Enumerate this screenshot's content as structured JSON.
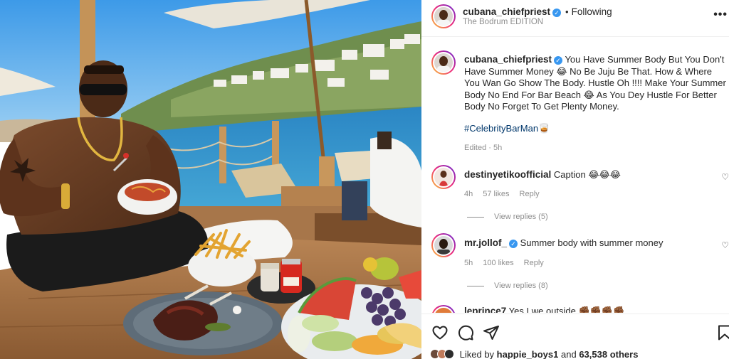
{
  "post": {
    "author": "cubana_chiefpriest",
    "verified_mark": "✓",
    "separator": "•",
    "following_label": "Following",
    "location": "The Bodrum EDITION",
    "more_icon": "more-horizontal-icon"
  },
  "caption": {
    "author": "cubana_chiefpriest",
    "text": "You Have Summer Body But You Don't Have Summer Money 😂 No Be Juju Be That. How & Where You Wan Go Show The Body. Hustle Oh !!!! Make Your Summer Body No End For Bar Beach 😂 As You Dey Hustle For Better Body No Forget To Get Plenty Money.",
    "hashtag": "#CelebrityBarMan🥃",
    "edited": "Edited",
    "time": "5h"
  },
  "comments": [
    {
      "author": "destinyetikoofficial",
      "text": "Caption 😂😂😂",
      "time": "4h",
      "likes": "57 likes",
      "reply": "Reply",
      "view_replies": "View replies (5)"
    },
    {
      "author": "mr.jollof_",
      "text": "Summer body with summer money",
      "time": "5h",
      "likes": "100 likes",
      "reply": "Reply",
      "view_replies": "View replies (8)"
    },
    {
      "author": "leprince7",
      "text": "Yes I we outside ✊🏾✊🏾✊🏾✊🏾"
    }
  ],
  "actions": {
    "like_icon": "heart-icon",
    "comment_icon": "comment-icon",
    "share_icon": "share-icon",
    "save_icon": "bookmark-icon"
  },
  "likes_line": {
    "prefix": "Liked by",
    "user": "happie_boys1",
    "middle": "and",
    "count": "63,538 others"
  },
  "colors": {
    "verified": "#3897f0",
    "hashtag": "#00376b",
    "muted": "#8e8e8e",
    "sea": "#2f8fc7",
    "sky": "#4aa6ec"
  }
}
